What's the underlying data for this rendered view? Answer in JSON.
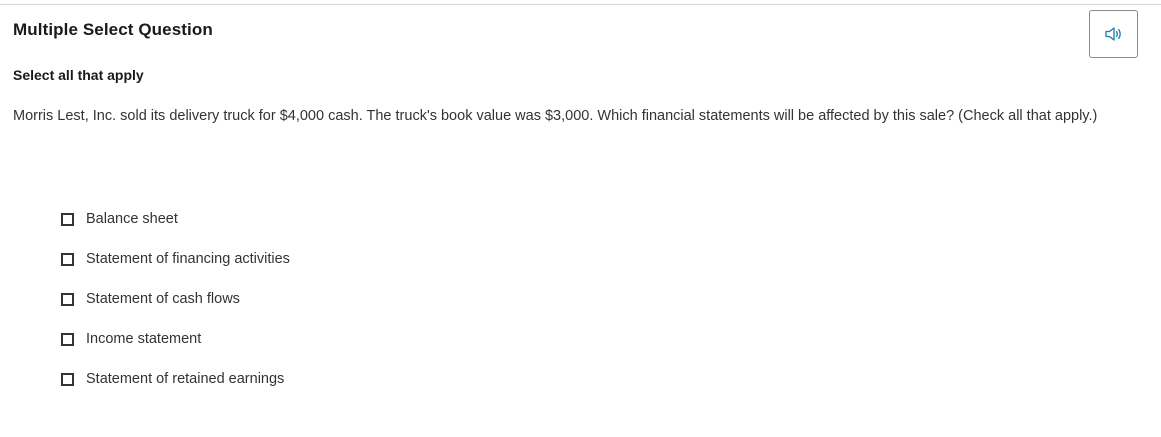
{
  "question": {
    "type_label": "Multiple Select Question",
    "instruction": "Select all that apply",
    "prompt": "Morris Lest, Inc. sold its delivery truck for $4,000 cash. The truck's book value was $3,000. Which financial statements will be affected by this sale? (Check all that apply.)"
  },
  "audio_button": {
    "icon": "speaker-icon",
    "icon_color": "#1a7fa0"
  },
  "options": [
    {
      "label": "Balance sheet",
      "checked": false
    },
    {
      "label": "Statement of financing activities",
      "checked": false
    },
    {
      "label": "Statement of cash flows",
      "checked": false
    },
    {
      "label": "Income statement",
      "checked": false
    },
    {
      "label": "Statement of retained earnings",
      "checked": false
    }
  ]
}
